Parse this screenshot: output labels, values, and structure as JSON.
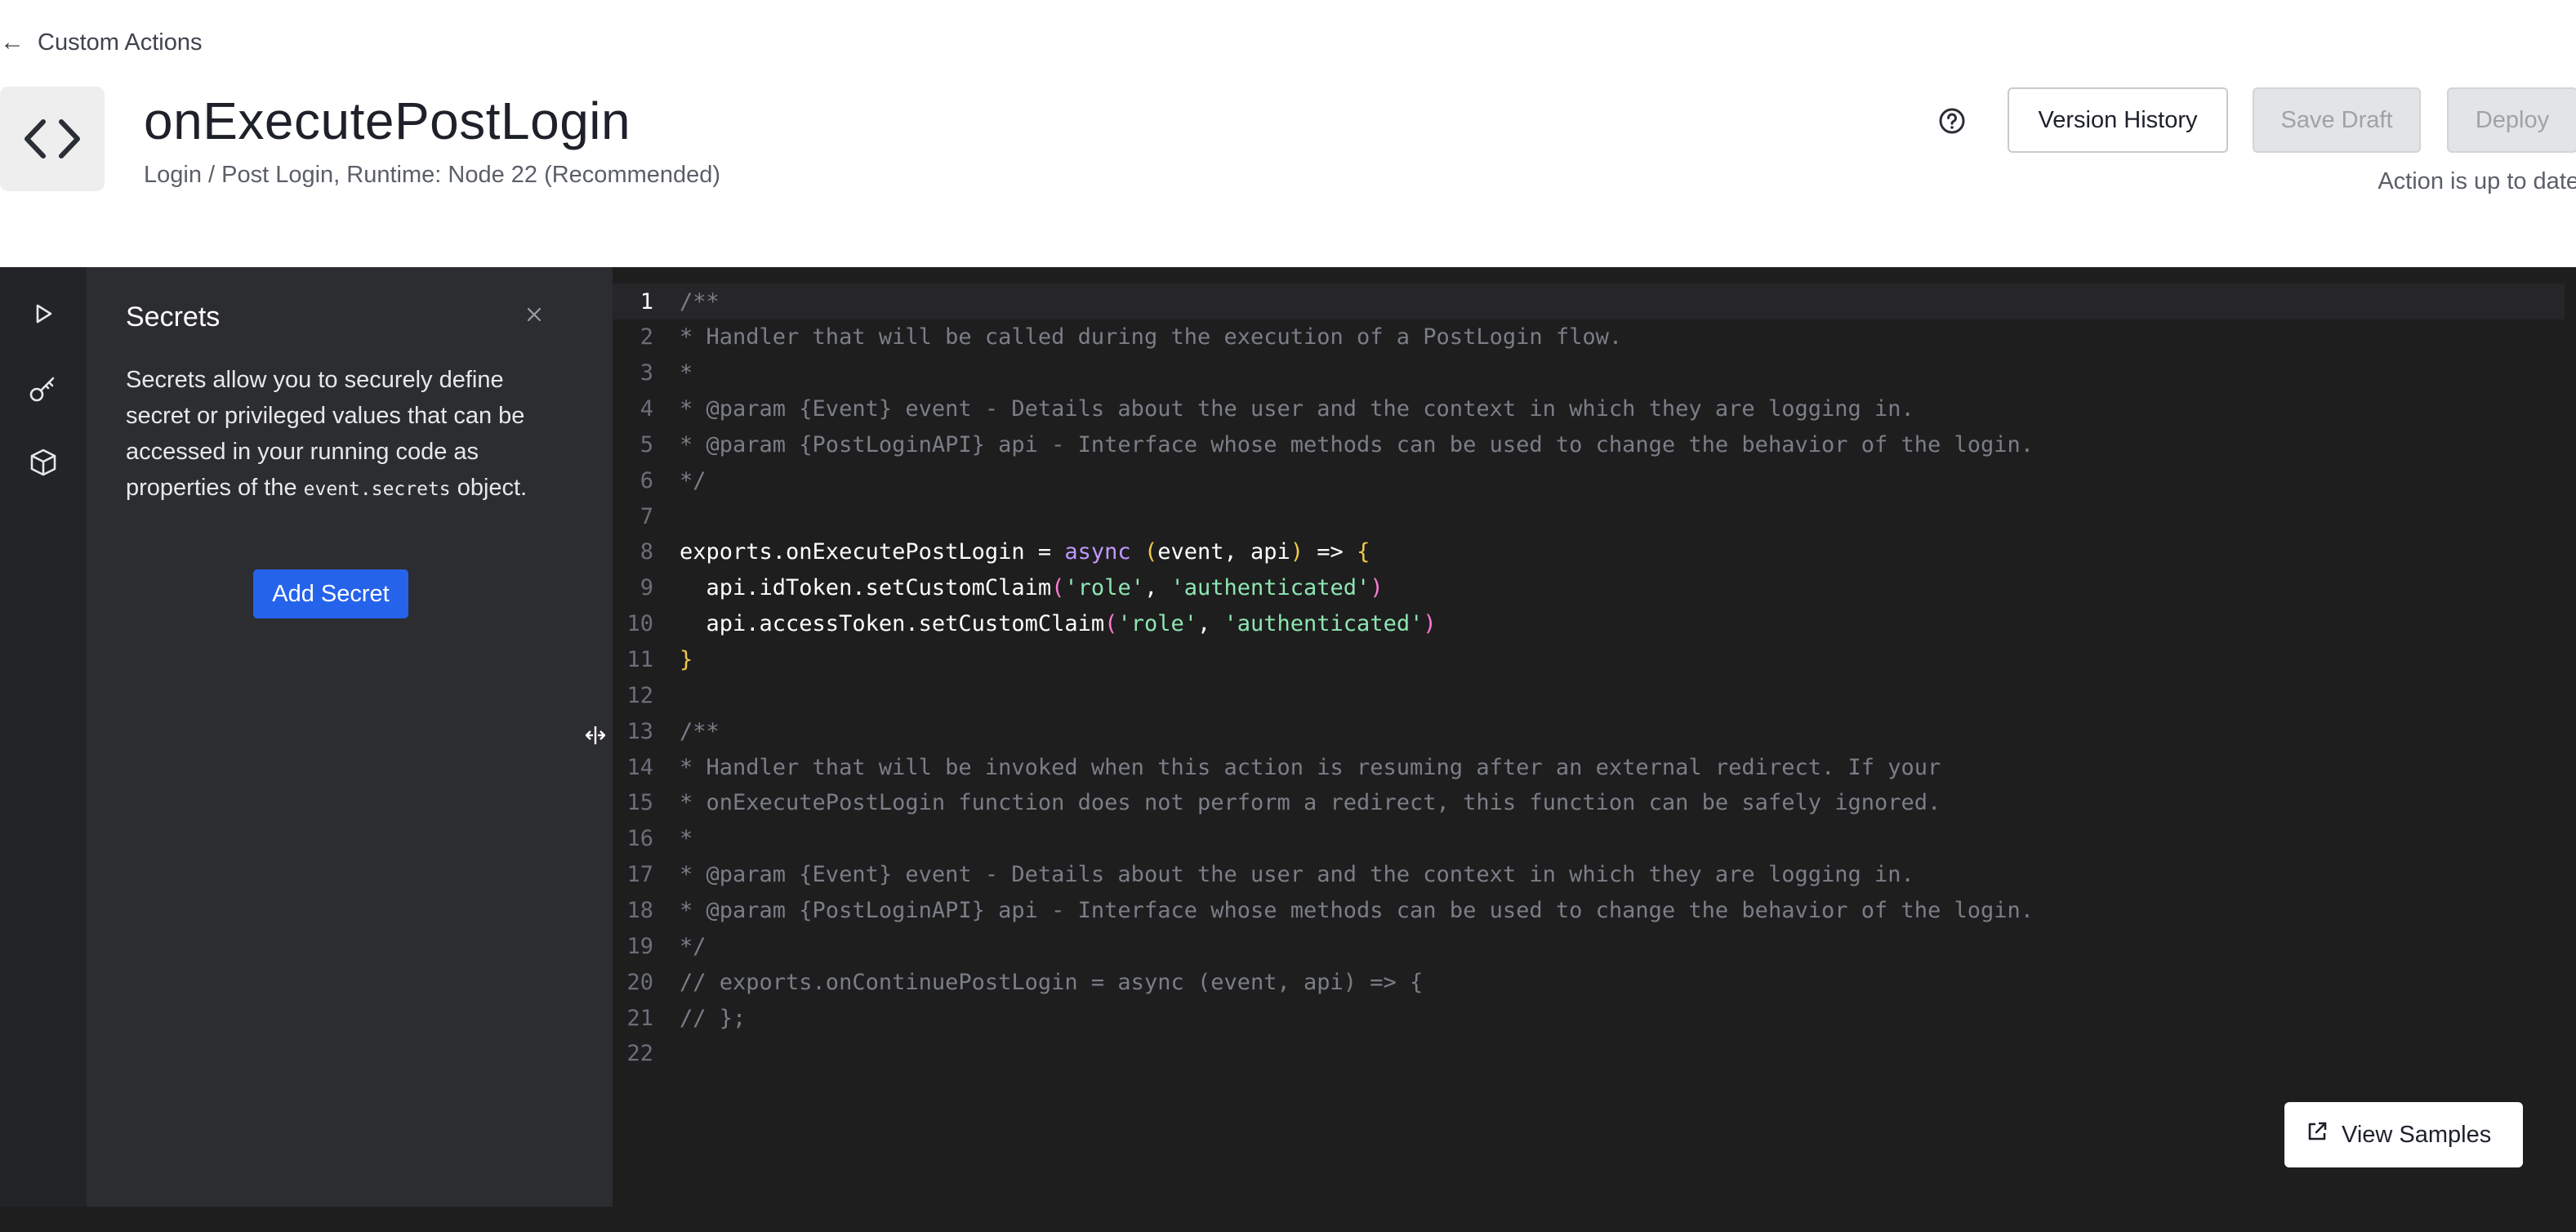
{
  "breadcrumb": {
    "label": "Custom Actions",
    "icon": "arrow-left-icon"
  },
  "header": {
    "title": "onExecutePostLogin",
    "subtitle": "Login / Post Login, Runtime: Node 22 (Recommended)",
    "help_icon": "question-circle-icon",
    "version_history_label": "Version History",
    "save_draft_label": "Save Draft",
    "deploy_label": "Deploy",
    "status": "Action is up to date"
  },
  "toolstrip": {
    "items": [
      {
        "name": "run",
        "icon": "play-icon"
      },
      {
        "name": "secrets",
        "icon": "key-icon"
      },
      {
        "name": "dependencies",
        "icon": "cube-icon"
      }
    ]
  },
  "secrets_panel": {
    "title": "Secrets",
    "description_before": "Secrets allow you to securely define secret or privileged values that can be accessed in your running code as properties of the",
    "description_code": "event.secrets",
    "description_after": "object.",
    "add_button": "Add Secret"
  },
  "editor": {
    "active_line": 1,
    "lines": [
      [
        [
          "c",
          "/**"
        ]
      ],
      [
        [
          "c",
          "* Handler that will be called during the execution of a PostLogin flow."
        ]
      ],
      [
        [
          "c",
          "*"
        ]
      ],
      [
        [
          "c",
          "* @param {Event} event - Details about the user and the context in which they are logging in."
        ]
      ],
      [
        [
          "c",
          "* @param {PostLoginAPI} api - Interface whose methods can be used to change the behavior of the login."
        ]
      ],
      [
        [
          "c",
          "*/"
        ]
      ],
      [],
      [
        [
          "i",
          "exports.onExecutePostLogin = "
        ],
        [
          "k",
          "async"
        ],
        [
          "i",
          " "
        ],
        [
          "p1",
          "("
        ],
        [
          "i",
          "event, api"
        ],
        [
          "p1",
          ")"
        ],
        [
          "i",
          " => "
        ],
        [
          "p1",
          "{"
        ]
      ],
      [
        [
          "i",
          "  api.idToken.setCustomClaim"
        ],
        [
          "p2",
          "("
        ],
        [
          "s",
          "'role'"
        ],
        [
          "i",
          ", "
        ],
        [
          "s",
          "'authenticated'"
        ],
        [
          "p2",
          ")"
        ]
      ],
      [
        [
          "i",
          "  api.accessToken.setCustomClaim"
        ],
        [
          "p2",
          "("
        ],
        [
          "s",
          "'role'"
        ],
        [
          "i",
          ", "
        ],
        [
          "s",
          "'authenticated'"
        ],
        [
          "p2",
          ")"
        ]
      ],
      [
        [
          "p1",
          "}"
        ]
      ],
      [],
      [
        [
          "c",
          "/**"
        ]
      ],
      [
        [
          "c",
          "* Handler that will be invoked when this action is resuming after an external redirect. If your"
        ]
      ],
      [
        [
          "c",
          "* onExecutePostLogin function does not perform a redirect, this function can be safely ignored."
        ]
      ],
      [
        [
          "c",
          "*"
        ]
      ],
      [
        [
          "c",
          "* @param {Event} event - Details about the user and the context in which they are logging in."
        ]
      ],
      [
        [
          "c",
          "* @param {PostLoginAPI} api - Interface whose methods can be used to change the behavior of the login."
        ]
      ],
      [
        [
          "c",
          "*/"
        ]
      ],
      [
        [
          "c",
          "// exports.onContinuePostLogin = async (event, api) => {"
        ]
      ],
      [
        [
          "c",
          "// };"
        ]
      ],
      []
    ]
  },
  "view_samples": {
    "label": "View Samples",
    "icon": "external-link-icon"
  }
}
